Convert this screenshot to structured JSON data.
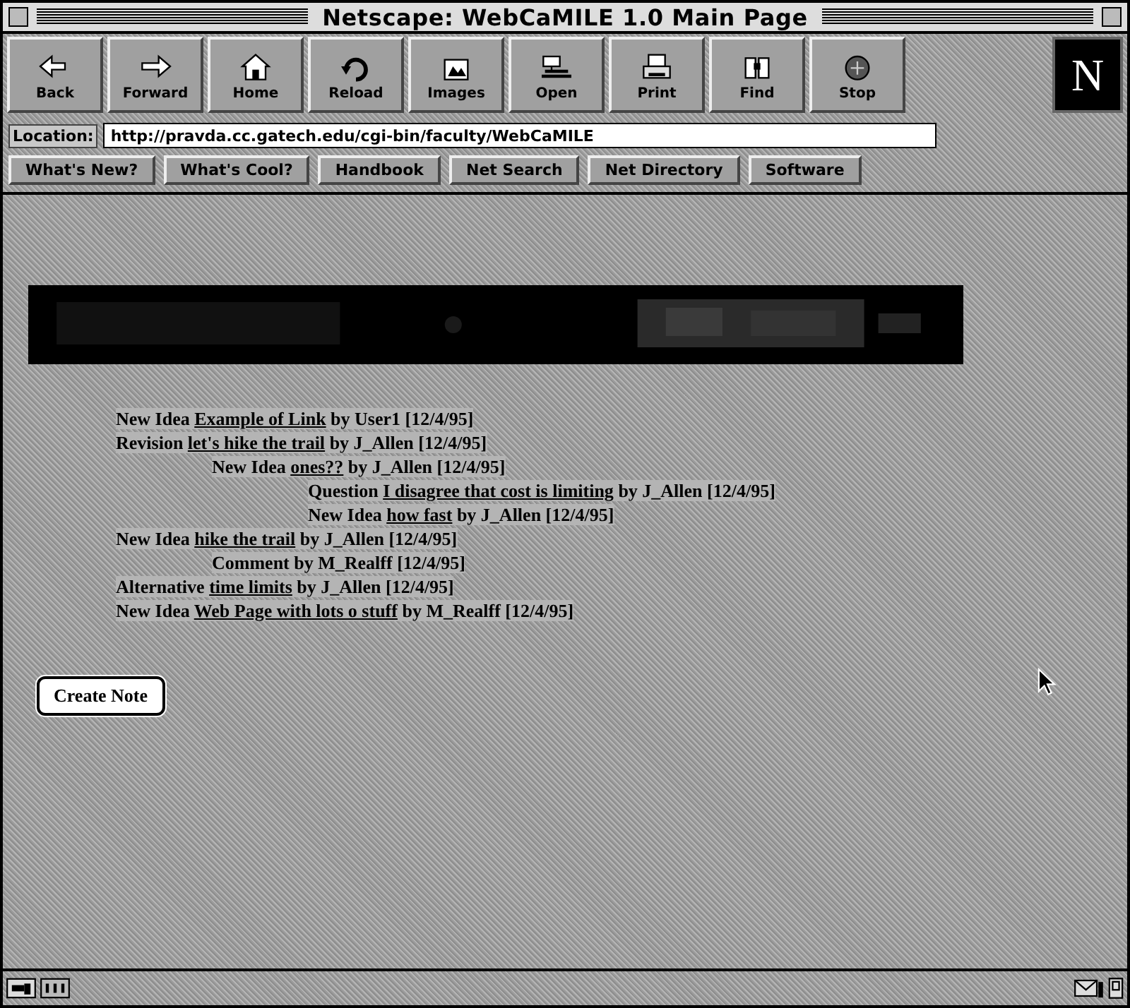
{
  "window": {
    "title": "Netscape: WebCaMILE 1.0 Main Page"
  },
  "toolbar": [
    {
      "label": "Back"
    },
    {
      "label": "Forward"
    },
    {
      "label": "Home"
    },
    {
      "label": "Reload"
    },
    {
      "label": "Images"
    },
    {
      "label": "Open"
    },
    {
      "label": "Print"
    },
    {
      "label": "Find"
    },
    {
      "label": "Stop"
    }
  ],
  "logo": {
    "letter": "N"
  },
  "location": {
    "label": "Location:",
    "value": "http://pravda.cc.gatech.edu/cgi-bin/faculty/WebCaMILE"
  },
  "directory_buttons": [
    "What's New?",
    "What's Cool?",
    "Handbook",
    "Net Search",
    "Net Directory",
    "Software"
  ],
  "notes": [
    {
      "type": "New Idea",
      "title": "Example of Link",
      "byline": "by User1 [12/4/95]"
    },
    {
      "type": "Revision",
      "title": "let's hike the trail",
      "byline": "by J_Allen [12/4/95]",
      "children": [
        {
          "type": "New Idea",
          "title": "ones??",
          "byline": "by J_Allen [12/4/95]",
          "children": [
            {
              "type": "Question",
              "title": "I disagree that cost is limiting",
              "byline": "by J_Allen [12/4/95]"
            },
            {
              "type": "New Idea",
              "title": "how fast",
              "byline": "by J_Allen [12/4/95]"
            }
          ]
        }
      ]
    },
    {
      "type": "New Idea",
      "title": "hike the trail",
      "byline": "by J_Allen [12/4/95]",
      "children": [
        {
          "type": "Comment",
          "byline": "by M_Realff [12/4/95]"
        }
      ]
    },
    {
      "type": "Alternative",
      "title": "time limits",
      "byline": "by J_Allen [12/4/95]"
    },
    {
      "type": "New Idea",
      "title": "Web Page with lots o stuff",
      "byline": "by M_Realff [12/4/95]"
    }
  ],
  "create_button": {
    "label": "Create Note"
  }
}
